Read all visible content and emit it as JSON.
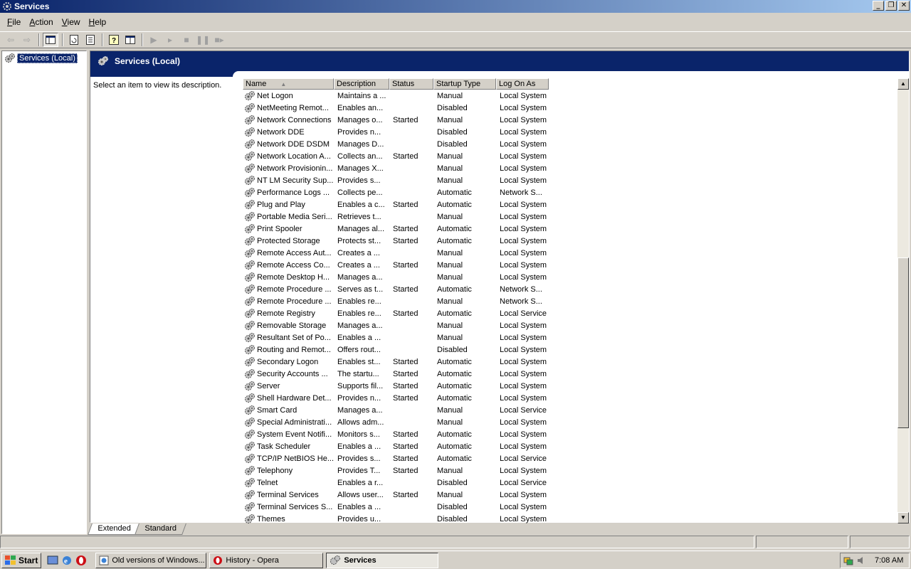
{
  "window": {
    "title": "Services"
  },
  "menu": [
    {
      "label": "File",
      "key": "F",
      "rest": "ile"
    },
    {
      "label": "Action",
      "key": "A",
      "rest": "ction"
    },
    {
      "label": "View",
      "key": "V",
      "rest": "iew"
    },
    {
      "label": "Help",
      "key": "H",
      "rest": "elp"
    }
  ],
  "tree": {
    "root_label": "Services (Local)"
  },
  "pane": {
    "header_title": "Services (Local)",
    "description_prompt": "Select an item to view its description."
  },
  "columns": {
    "name": "Name",
    "description": "Description",
    "status": "Status",
    "startup": "Startup Type",
    "logon": "Log On As"
  },
  "services": [
    {
      "name": "Net Logon",
      "desc": "Maintains a ...",
      "status": "",
      "startup": "Manual",
      "logon": "Local System"
    },
    {
      "name": "NetMeeting Remot...",
      "desc": "Enables an...",
      "status": "",
      "startup": "Disabled",
      "logon": "Local System"
    },
    {
      "name": "Network Connections",
      "desc": "Manages o...",
      "status": "Started",
      "startup": "Manual",
      "logon": "Local System"
    },
    {
      "name": "Network DDE",
      "desc": "Provides n...",
      "status": "",
      "startup": "Disabled",
      "logon": "Local System"
    },
    {
      "name": "Network DDE DSDM",
      "desc": "Manages D...",
      "status": "",
      "startup": "Disabled",
      "logon": "Local System"
    },
    {
      "name": "Network Location A...",
      "desc": "Collects an...",
      "status": "Started",
      "startup": "Manual",
      "logon": "Local System"
    },
    {
      "name": "Network Provisionin...",
      "desc": "Manages X...",
      "status": "",
      "startup": "Manual",
      "logon": "Local System"
    },
    {
      "name": "NT LM Security Sup...",
      "desc": "Provides s...",
      "status": "",
      "startup": "Manual",
      "logon": "Local System"
    },
    {
      "name": "Performance Logs ...",
      "desc": "Collects pe...",
      "status": "",
      "startup": "Automatic",
      "logon": "Network S..."
    },
    {
      "name": "Plug and Play",
      "desc": "Enables a c...",
      "status": "Started",
      "startup": "Automatic",
      "logon": "Local System"
    },
    {
      "name": "Portable Media Seri...",
      "desc": "Retrieves t...",
      "status": "",
      "startup": "Manual",
      "logon": "Local System"
    },
    {
      "name": "Print Spooler",
      "desc": "Manages al...",
      "status": "Started",
      "startup": "Automatic",
      "logon": "Local System"
    },
    {
      "name": "Protected Storage",
      "desc": "Protects st...",
      "status": "Started",
      "startup": "Automatic",
      "logon": "Local System"
    },
    {
      "name": "Remote Access Aut...",
      "desc": "Creates a ...",
      "status": "",
      "startup": "Manual",
      "logon": "Local System"
    },
    {
      "name": "Remote Access Co...",
      "desc": "Creates a ...",
      "status": "Started",
      "startup": "Manual",
      "logon": "Local System"
    },
    {
      "name": "Remote Desktop H...",
      "desc": "Manages a...",
      "status": "",
      "startup": "Manual",
      "logon": "Local System"
    },
    {
      "name": "Remote Procedure ...",
      "desc": "Serves as t...",
      "status": "Started",
      "startup": "Automatic",
      "logon": "Network S..."
    },
    {
      "name": "Remote Procedure ...",
      "desc": "Enables re...",
      "status": "",
      "startup": "Manual",
      "logon": "Network S..."
    },
    {
      "name": "Remote Registry",
      "desc": "Enables re...",
      "status": "Started",
      "startup": "Automatic",
      "logon": "Local Service"
    },
    {
      "name": "Removable Storage",
      "desc": "Manages a...",
      "status": "",
      "startup": "Manual",
      "logon": "Local System"
    },
    {
      "name": "Resultant Set of Po...",
      "desc": "Enables a ...",
      "status": "",
      "startup": "Manual",
      "logon": "Local System"
    },
    {
      "name": "Routing and Remot...",
      "desc": "Offers rout...",
      "status": "",
      "startup": "Disabled",
      "logon": "Local System"
    },
    {
      "name": "Secondary Logon",
      "desc": "Enables st...",
      "status": "Started",
      "startup": "Automatic",
      "logon": "Local System"
    },
    {
      "name": "Security Accounts ...",
      "desc": "The startu...",
      "status": "Started",
      "startup": "Automatic",
      "logon": "Local System"
    },
    {
      "name": "Server",
      "desc": "Supports fil...",
      "status": "Started",
      "startup": "Automatic",
      "logon": "Local System"
    },
    {
      "name": "Shell Hardware Det...",
      "desc": "Provides n...",
      "status": "Started",
      "startup": "Automatic",
      "logon": "Local System"
    },
    {
      "name": "Smart Card",
      "desc": "Manages a...",
      "status": "",
      "startup": "Manual",
      "logon": "Local Service"
    },
    {
      "name": "Special Administrati...",
      "desc": "Allows adm...",
      "status": "",
      "startup": "Manual",
      "logon": "Local System"
    },
    {
      "name": "System Event Notifi...",
      "desc": "Monitors s...",
      "status": "Started",
      "startup": "Automatic",
      "logon": "Local System"
    },
    {
      "name": "Task Scheduler",
      "desc": "Enables a ...",
      "status": "Started",
      "startup": "Automatic",
      "logon": "Local System"
    },
    {
      "name": "TCP/IP NetBIOS He...",
      "desc": "Provides s...",
      "status": "Started",
      "startup": "Automatic",
      "logon": "Local Service"
    },
    {
      "name": "Telephony",
      "desc": "Provides T...",
      "status": "Started",
      "startup": "Manual",
      "logon": "Local System"
    },
    {
      "name": "Telnet",
      "desc": "Enables a r...",
      "status": "",
      "startup": "Disabled",
      "logon": "Local Service"
    },
    {
      "name": "Terminal Services",
      "desc": "Allows user...",
      "status": "Started",
      "startup": "Manual",
      "logon": "Local System"
    },
    {
      "name": "Terminal Services S...",
      "desc": "Enables a ...",
      "status": "",
      "startup": "Disabled",
      "logon": "Local System"
    },
    {
      "name": "Themes",
      "desc": "Provides u...",
      "status": "",
      "startup": "Disabled",
      "logon": "Local System"
    }
  ],
  "tabs": {
    "extended": "Extended",
    "standard": "Standard"
  },
  "taskbar": {
    "start_label": "Start",
    "tasks": [
      {
        "label": "Old versions of Windows..."
      },
      {
        "label": "History - Opera"
      },
      {
        "label": "Services"
      }
    ],
    "clock": "7:08 AM"
  }
}
